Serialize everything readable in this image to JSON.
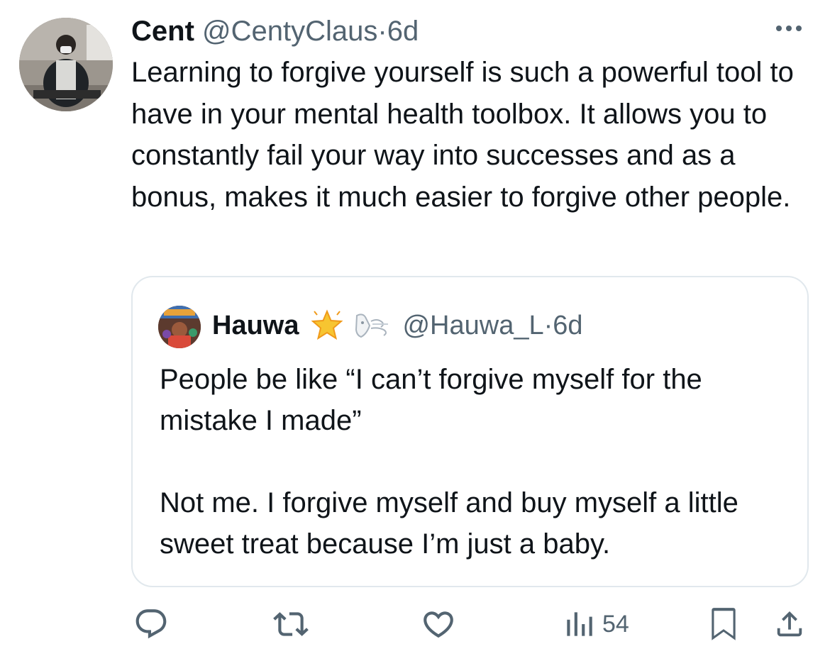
{
  "tweet": {
    "author_name": "Cent",
    "handle": "@CentyClaus",
    "separator": "·",
    "time": "6d",
    "text": "Learning to forgive yourself is such a powerful tool to have in your mental health toolbox. It allows you to constantly fail your way into successes and as a bonus, makes it much easier to forgive other people."
  },
  "quoted": {
    "author_name": "Hauwa",
    "emoji_icons": [
      "glowing-star-icon",
      "wind-face-icon"
    ],
    "handle": "@Hauwa_L",
    "separator": "·",
    "time": "6d",
    "paragraph1": "People be like “I can’t forgive myself for the mistake I made”",
    "paragraph2": "Not me. I forgive myself and buy myself a little sweet treat because I’m just a baby."
  },
  "actions": {
    "views": "54",
    "icons": [
      "reply-icon",
      "retweet-icon",
      "like-icon",
      "views-icon",
      "bookmark-icon",
      "share-icon"
    ]
  },
  "colors": {
    "text": "#0f1419",
    "muted": "#536471",
    "border": "#e1e8ed",
    "star": "#f7c531"
  }
}
